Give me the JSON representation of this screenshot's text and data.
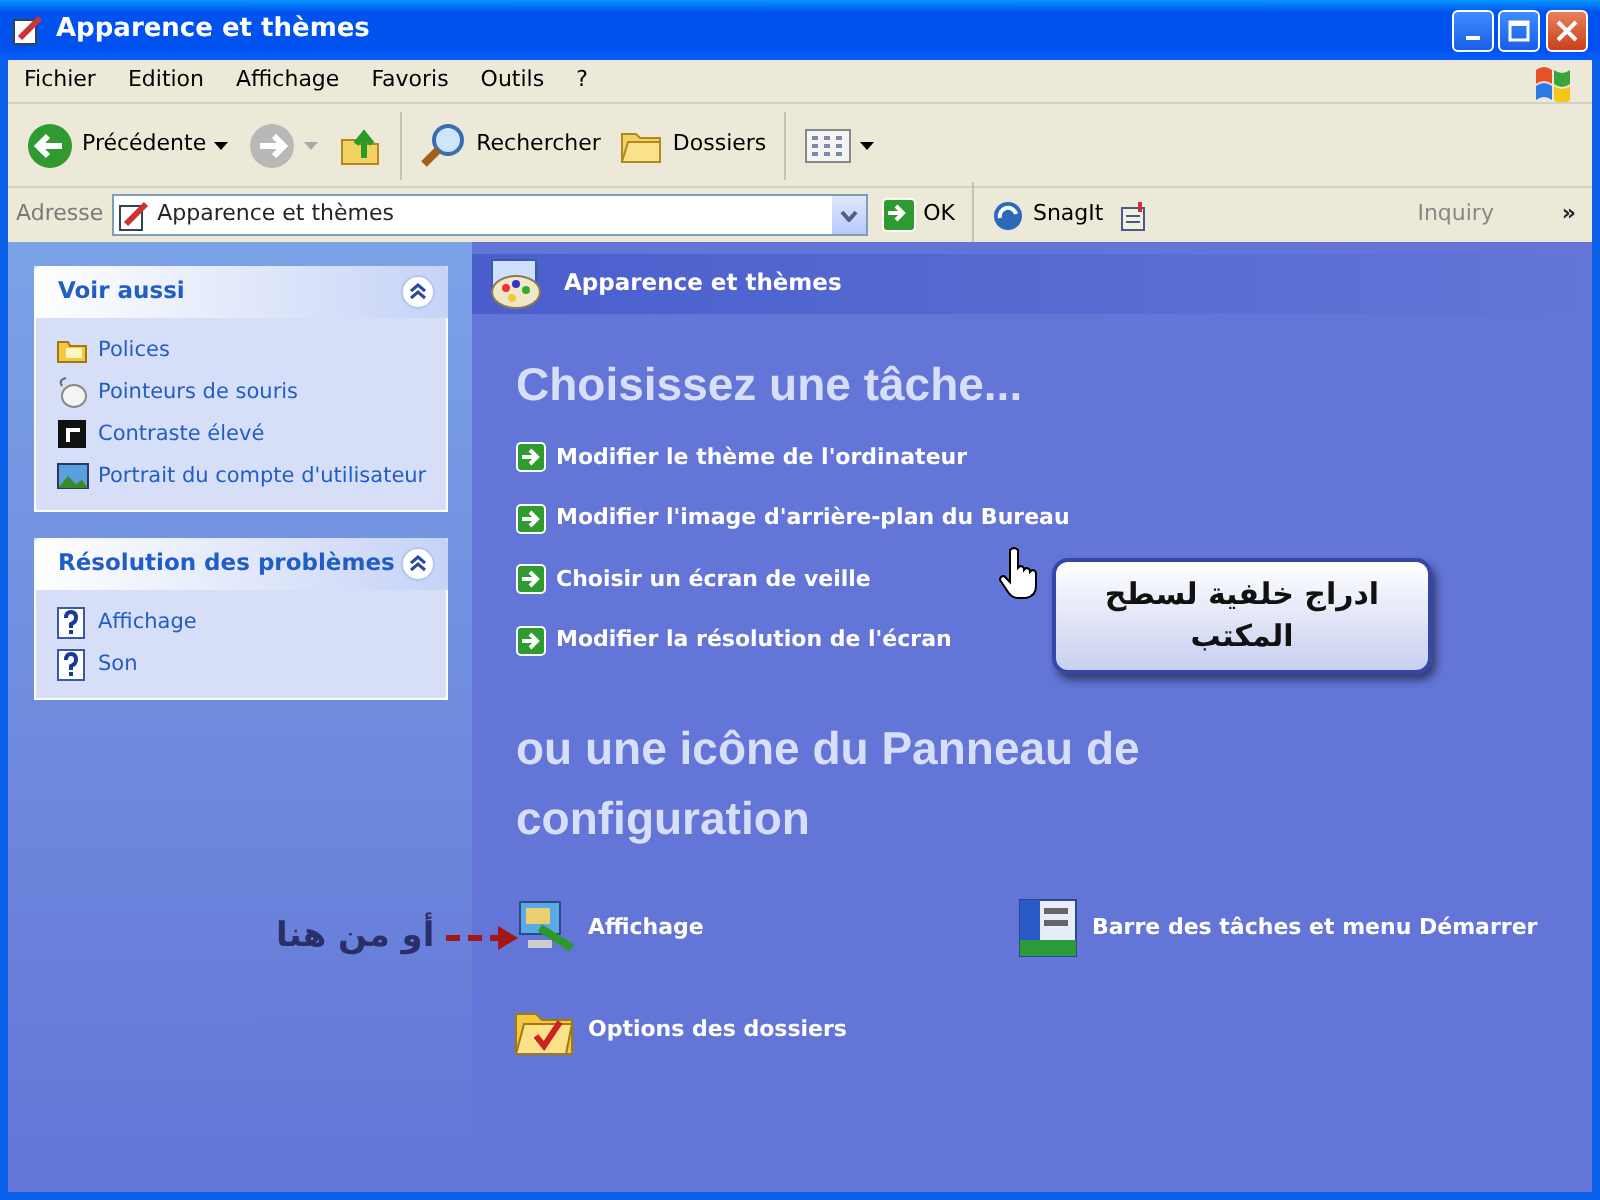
{
  "window": {
    "title": "Apparence et thèmes"
  },
  "menu": [
    "Fichier",
    "Edition",
    "Affichage",
    "Favoris",
    "Outils",
    "?"
  ],
  "toolbar": {
    "back": {
      "label": "Précédente",
      "disabled": false
    },
    "forward": {
      "disabled": true
    },
    "search": "Rechercher",
    "folders": "Dossiers"
  },
  "address": {
    "label": "Adresse",
    "value": "Apparence et thèmes",
    "go": "OK",
    "snagit": "SnagIt",
    "inquiry": "Inquiry",
    "chevron": "»"
  },
  "sidebar": [
    {
      "title": "Voir aussi",
      "items": [
        {
          "label": "Polices",
          "kind": "fonts"
        },
        {
          "label": "Pointeurs de souris",
          "kind": "mouse"
        },
        {
          "label": "Contraste élevé",
          "kind": "contrast"
        },
        {
          "label": "Portrait du compte d'utilisateur",
          "kind": "picture"
        }
      ]
    },
    {
      "title": "Résolution des problèmes",
      "items": [
        {
          "label": "Affichage",
          "kind": "help"
        },
        {
          "label": "Son",
          "kind": "help"
        }
      ]
    }
  ],
  "category": {
    "title": "Apparence et thèmes"
  },
  "tasks_heading": "Choisissez une tâche...",
  "tasks": [
    "Modifier le thème de l'ordinateur",
    "Modifier l'image d'arrière-plan du Bureau",
    "Choisir un écran de veille",
    "Modifier la résolution de l'écran"
  ],
  "icons_heading": "ou une icône du Panneau de configuration",
  "icons": [
    {
      "label": "Affichage",
      "kind": "display"
    },
    {
      "label": "Barre des tâches et menu Démarrer",
      "kind": "taskbar"
    },
    {
      "label": "Options des dossiers",
      "kind": "folder-options"
    }
  ],
  "annotations": {
    "callout": "ادراج خلفية لسطح المكتب",
    "pointer": "أو من هنا"
  }
}
